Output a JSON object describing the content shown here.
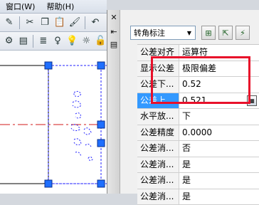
{
  "menubar": {
    "items": [
      "窗口(W)",
      "帮助(H)"
    ]
  },
  "palette": {
    "close_glyph": "✕",
    "combo": {
      "value": "转角标注",
      "arrow": "▼"
    },
    "properties": [
      {
        "name": "公差对齐",
        "value": "运算符"
      },
      {
        "name": "显示公差",
        "value": "极限偏差"
      },
      {
        "name": "公差下...",
        "value": "0.52"
      },
      {
        "name": "公差上...",
        "value": "0.521"
      },
      {
        "name": "水平放...",
        "value": "下"
      },
      {
        "name": "公差精度",
        "value": "0.0000"
      },
      {
        "name": "公差消...",
        "value": "否"
      },
      {
        "name": "公差消...",
        "value": "是"
      },
      {
        "name": "公差消...",
        "value": "是"
      },
      {
        "name": "公差消...",
        "value": "是"
      }
    ]
  },
  "colors": {
    "highlight": "#e8102a",
    "selection": "#3399ff",
    "grip": "#1f6fff",
    "dimension_line": "#2323ff"
  }
}
